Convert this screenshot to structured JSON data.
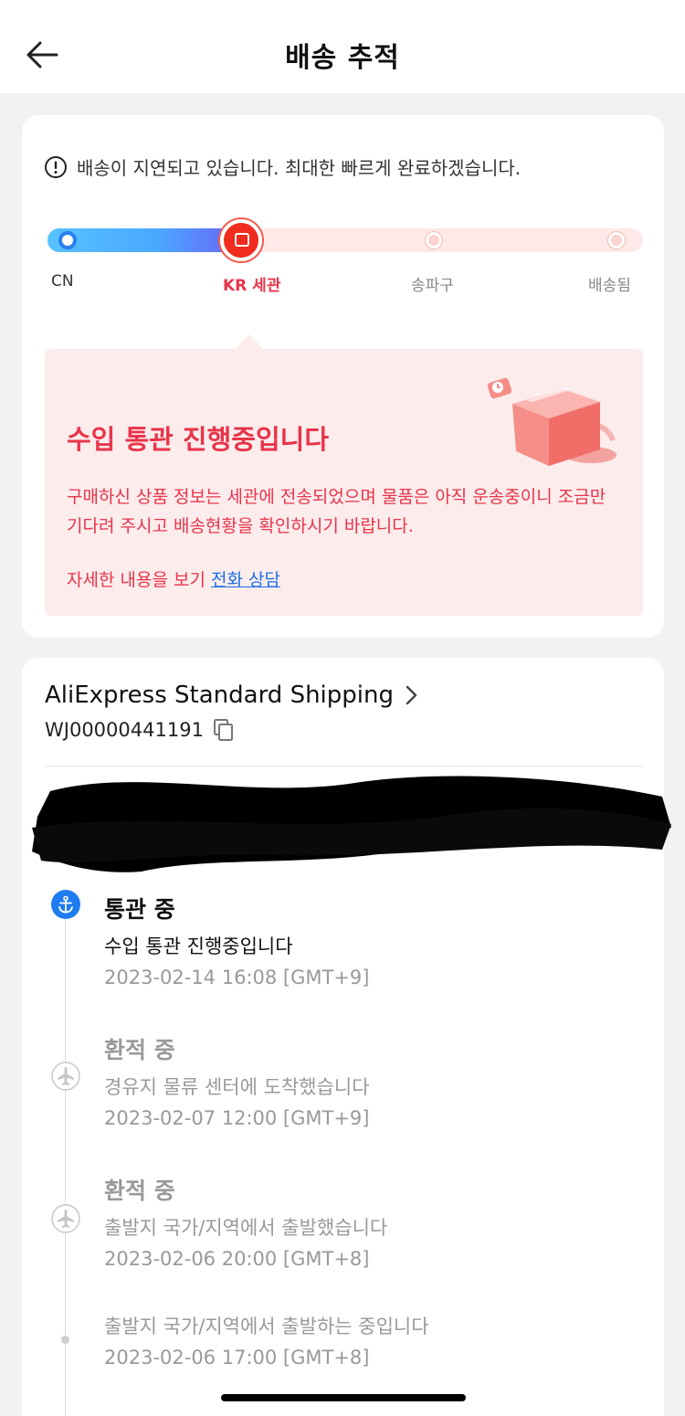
{
  "header": {
    "title": "배송 추적"
  },
  "notice": {
    "text": "배송이 지연되고 있습니다. 최대한 빠르게 완료하겠습니다."
  },
  "progress": {
    "stages": [
      "CN",
      "KR 세관",
      "송파구",
      "배송됨"
    ],
    "current_stage": "KR 세관"
  },
  "status_box": {
    "title": "수입 통관 진행중입니다",
    "description": " 구매하신 상품 정보는 세관에 전송되었으며 물품은 아직 운송중이니 조금만 기다려 주시고 배송현황을 확인하시기 바랍니다.",
    "more_text": "자세한 내용을 보기",
    "phone_link": "전화 상담"
  },
  "shipping": {
    "carrier": "AliExpress Standard Shipping",
    "tracking_number": "WJ00000441191"
  },
  "events": [
    {
      "title": "통관 중",
      "desc": "수입 통관 진행중입니다",
      "time": "2023-02-14 16:08 [GMT+9]",
      "icon": "anchor-icon"
    },
    {
      "title": "환적 중",
      "desc": "경유지 물류 센터에 도착했습니다",
      "time": "2023-02-07 12:00 [GMT+9]",
      "icon": "plane-icon"
    },
    {
      "title": "환적 중",
      "desc": "출발지 국가/지역에서 출발했습니다",
      "time": "2023-02-06 20:00 [GMT+8]",
      "icon": "plane-icon"
    },
    {
      "title": "",
      "desc": "출발지 국가/지역에서 출발하는 중입니다",
      "time": "2023-02-06 17:00 [GMT+8]",
      "icon": "dot"
    }
  ],
  "colors": {
    "accent_red": "#e8344a",
    "link_blue": "#1a6fe8",
    "active_blue": "#1e7cf0"
  }
}
